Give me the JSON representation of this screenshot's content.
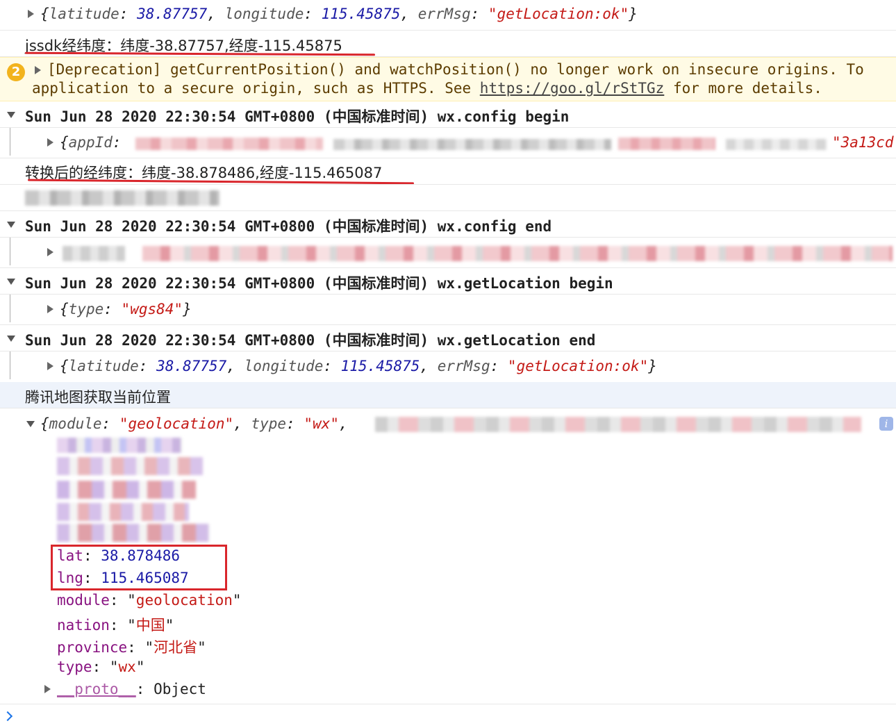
{
  "logs": {
    "l1": {
      "lat_key": "latitude",
      "lat": "38.87757",
      "lng_key": "longitude",
      "lng": "115.45875",
      "err_key": "errMsg",
      "err": "getLocation:ok"
    },
    "l2": "jssdk经纬度：纬度-38.87757,经度-115.45875",
    "warning": {
      "count": "2",
      "line1": "[Deprecation] getCurrentPosition() and watchPosition() no longer work on insecure origins. To",
      "line2_prefix": "application to a secure origin, such as HTTPS. See ",
      "link": "https://goo.gl/rStTGz",
      "line2_suffix": " for more details."
    },
    "g1_header": "Sun Jun 28 2020 22:30:54 GMT+0800 (中国标准时间) wx.config begin",
    "g1_child": {
      "key": "appId",
      "tail": "\"3a13cd"
    },
    "l3": "转换后的经纬度：纬度-38.878486,经度-115.465087",
    "g2_header": "Sun Jun 28 2020 22:30:54 GMT+0800 (中国标准时间) wx.config end",
    "g3_header": "Sun Jun 28 2020 22:30:54 GMT+0800 (中国标准时间) wx.getLocation begin",
    "g3_child": {
      "key": "type",
      "val": "wgs84"
    },
    "g4_header": "Sun Jun 28 2020 22:30:54 GMT+0800 (中国标准时间) wx.getLocation end",
    "g4_child": {
      "lat_key": "latitude",
      "lat": "38.87757",
      "lng_key": "longitude",
      "lng": "115.45875",
      "err_key": "errMsg",
      "err": "getLocation:ok"
    },
    "l4": "腾讯地图获取当前位置",
    "obj": {
      "preview_key1": "module",
      "preview_val1": "geolocation",
      "preview_key2": "type",
      "preview_val2": "wx",
      "info_icon": "i",
      "lat_key": "lat",
      "lat": "38.878486",
      "lng_key": "lng",
      "lng": "115.465087",
      "module_key": "module",
      "module": "geolocation",
      "nation_key": "nation",
      "nation": "中国",
      "province_key": "province",
      "province": "河北省",
      "type_key": "type",
      "type": "wx",
      "proto_key": "__proto__",
      "proto": "Object"
    },
    "prompt_icon": "chevron-right-icon"
  },
  "colors": {
    "annotation_red": "#d9262c",
    "warn_bg": "#fffbe5",
    "number": "#1a1aa6",
    "string": "#c41a16",
    "property": "#881280"
  }
}
